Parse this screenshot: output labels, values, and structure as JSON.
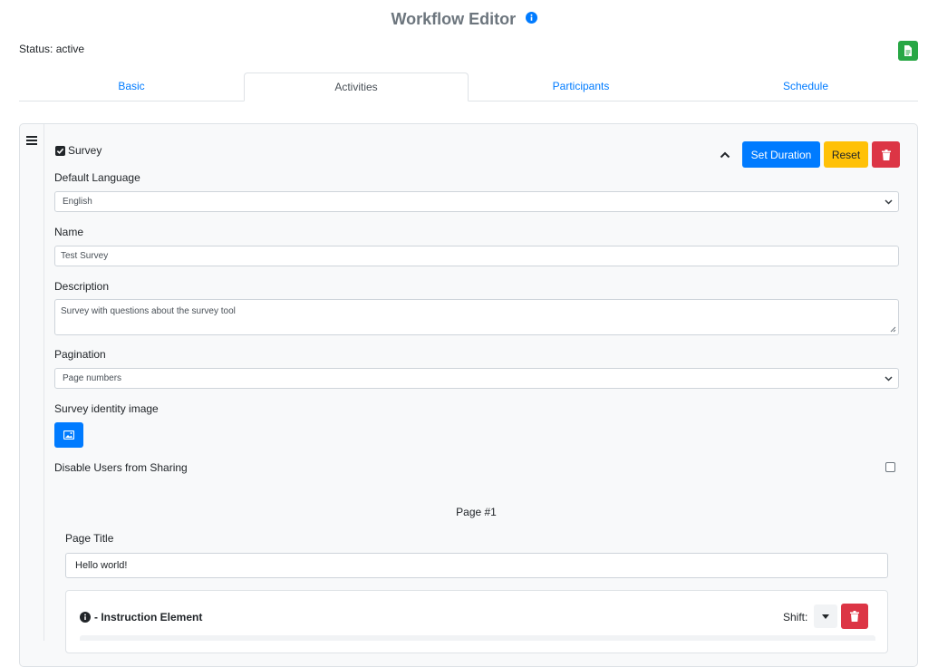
{
  "header": {
    "title": "Workflow Editor",
    "status_label": "Status:",
    "status_value": "active"
  },
  "tabs": [
    {
      "label": "Basic",
      "active": false
    },
    {
      "label": "Activities",
      "active": true
    },
    {
      "label": "Participants",
      "active": false
    },
    {
      "label": "Schedule",
      "active": false
    }
  ],
  "activity": {
    "type_label": "Survey",
    "type_checked": true,
    "buttons": {
      "set_duration": "Set Duration",
      "reset": "Reset"
    },
    "fields": {
      "default_language": {
        "label": "Default Language",
        "value": "English"
      },
      "name": {
        "label": "Name",
        "value": "Test Survey"
      },
      "description": {
        "label": "Description",
        "value": "Survey with questions about the survey tool"
      },
      "pagination": {
        "label": "Pagination",
        "value": "Page numbers"
      },
      "identity_image": {
        "label": "Survey identity image"
      },
      "disable_sharing": {
        "label": "Disable Users from Sharing",
        "checked": false
      }
    },
    "page": {
      "number_label": "Page #1",
      "title_label": "Page Title",
      "title_value": "Hello world!",
      "element": {
        "title": "- Instruction Element",
        "shift_label": "Shift:"
      }
    }
  },
  "colors": {
    "primary": "#007bff",
    "success": "#28a745",
    "warning": "#ffc107",
    "danger": "#dc3545",
    "muted_title": "#6c757d"
  }
}
